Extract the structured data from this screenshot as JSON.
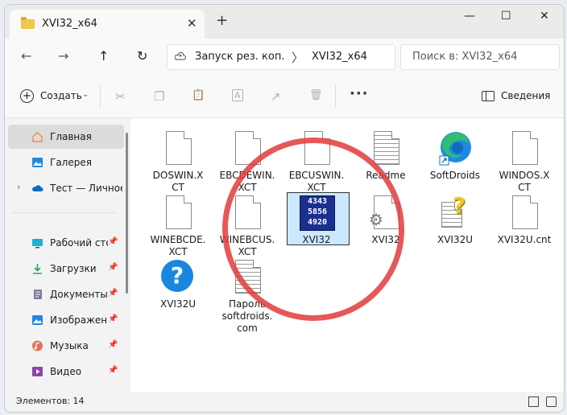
{
  "window": {
    "tab_title": "XVI32_x64",
    "tab_close": "✕",
    "tab_new": "+",
    "minimize": "—",
    "maximize": "☐",
    "close": "✕"
  },
  "nav": {
    "back": "←",
    "forward": "→",
    "up": "↑",
    "refresh": "↻",
    "breadcrumb": [
      "Запуск рез. коп.",
      "XVI32_x64"
    ],
    "breadcrumb_chevron": "〉",
    "search_placeholder": "Поиск в: XVI32_x64"
  },
  "toolbar": {
    "create_label": "Создать",
    "create_plus": "+",
    "create_chevron": "⌄",
    "cut": "✂",
    "copy": "❐",
    "paste": "📋",
    "rename": "A",
    "share": "↗",
    "delete": "🗑",
    "more": "···",
    "details_label": "Сведения"
  },
  "sidebar": {
    "items": [
      {
        "label": "Главная",
        "icon": "home-icon",
        "color": "#f08a4b"
      },
      {
        "label": "Галерея",
        "icon": "gallery-icon",
        "color": "#1e88e5"
      },
      {
        "label": "Тест — Личное",
        "icon": "cloud-icon",
        "color": "#0f6cbd"
      },
      {
        "label": "Рабочий стол",
        "icon": "desktop-icon",
        "color": "#1db0d6",
        "pin": "📌"
      },
      {
        "label": "Загрузки",
        "icon": "download-icon",
        "color": "#2e9e5b",
        "pin": "📌"
      },
      {
        "label": "Документы",
        "icon": "documents-icon",
        "color": "#7a7a9a",
        "pin": "📌"
      },
      {
        "label": "Изображения",
        "icon": "pictures-icon",
        "color": "#1e88e5",
        "pin": "📌"
      },
      {
        "label": "Музыка",
        "icon": "music-icon",
        "color": "#e2705c",
        "pin": "📌"
      },
      {
        "label": "Видео",
        "icon": "video-icon",
        "color": "#8e44ad",
        "pin": "📌"
      }
    ],
    "expand": "›"
  },
  "files": [
    {
      "name": "DOSWIN.XCT",
      "lines": [
        "DOSWIN.X",
        "CT"
      ],
      "icon": "document-icon"
    },
    {
      "name": "EBCDEWIN.XCT",
      "lines": [
        "EBCDEWIN.",
        "XCT"
      ],
      "icon": "document-icon"
    },
    {
      "name": "EBCUSWIN.XCT",
      "lines": [
        "EBCUSWIN.",
        "XCT"
      ],
      "icon": "document-icon"
    },
    {
      "name": "Readme",
      "lines": [
        "Readme"
      ],
      "icon": "text-document-icon"
    },
    {
      "name": "SoftDroids",
      "lines": [
        "SoftDroids"
      ],
      "icon": "edge-shortcut-icon"
    },
    {
      "name": "WINDOS.XCT",
      "lines": [
        "WINDOS.X",
        "CT"
      ],
      "icon": "document-icon"
    },
    {
      "name": "WINEBCDE.XCT",
      "lines": [
        "WINEBCDE.",
        "XCT"
      ],
      "icon": "document-icon"
    },
    {
      "name": "WINEBCUS.XCT",
      "lines": [
        "WINEBCUS.",
        "XCT"
      ],
      "icon": "document-icon"
    },
    {
      "name": "XVI32",
      "lines": [
        "XVI32"
      ],
      "icon": "hex-editor-icon",
      "hex": [
        "4343",
        "5856",
        "4920"
      ]
    },
    {
      "name": "XVI32",
      "lines": [
        "XVI32"
      ],
      "icon": "settings-file-icon"
    },
    {
      "name": "XVI32U",
      "lines": [
        "XVI32U"
      ],
      "icon": "help-file-icon"
    },
    {
      "name": "XVI32U.cnt",
      "lines": [
        "XVI32U.cnt"
      ],
      "icon": "document-icon"
    },
    {
      "name": "XVI32U",
      "lines": [
        "XVI32U"
      ],
      "icon": "help-icon",
      "glyph": "?"
    },
    {
      "name": "Пароль softdroids.com",
      "lines": [
        "Пароль",
        "softdroids.",
        "com"
      ],
      "icon": "text-document-icon"
    }
  ],
  "status": {
    "items_count": "Элементов: 14"
  },
  "colors": {
    "accent": "#0f6cbd",
    "highlight_circle": "#e23b3b",
    "selection": "#cce8ff"
  }
}
